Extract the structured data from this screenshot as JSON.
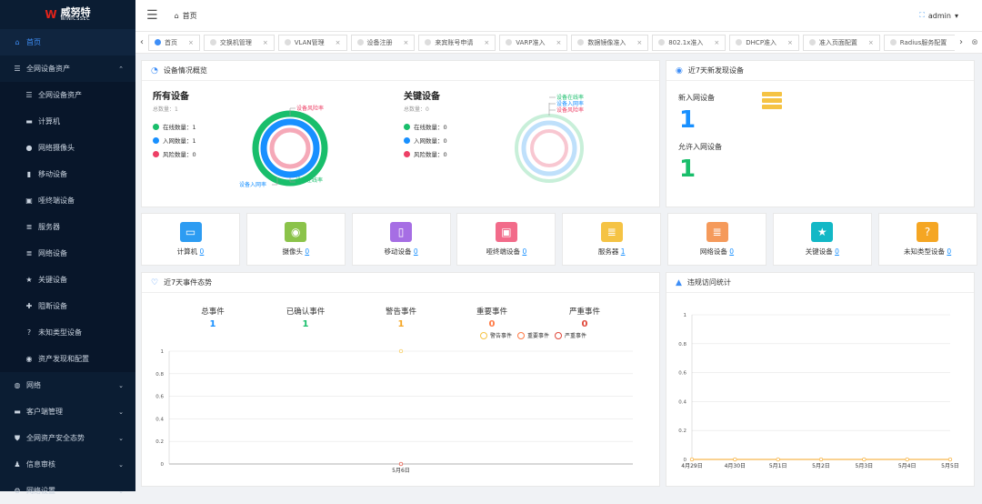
{
  "brand": {
    "name_cn": "威努特",
    "name_en": "WINICSSEC"
  },
  "sidebar": {
    "items": [
      {
        "label": "首页",
        "icon": "home-icon",
        "glyph": "⌂",
        "active": true
      },
      {
        "label": "全网设备资产",
        "icon": "list-icon",
        "glyph": "☰",
        "expanded": true
      },
      {
        "label": "全网设备资产",
        "icon": "list-icon",
        "glyph": "☰",
        "sub": true
      },
      {
        "label": "计算机",
        "icon": "computer-icon",
        "glyph": "▬",
        "sub": true
      },
      {
        "label": "网络摄像头",
        "icon": "camera-icon",
        "glyph": "●",
        "sub": true
      },
      {
        "label": "移动设备",
        "icon": "mobile-icon",
        "glyph": "▮",
        "sub": true
      },
      {
        "label": "哑终端设备",
        "icon": "printer-icon",
        "glyph": "▣",
        "sub": true
      },
      {
        "label": "服务器",
        "icon": "server-icon",
        "glyph": "≣",
        "sub": true
      },
      {
        "label": "网络设备",
        "icon": "network-device-icon",
        "glyph": "≣",
        "sub": true
      },
      {
        "label": "关键设备",
        "icon": "star-icon",
        "glyph": "★",
        "sub": true
      },
      {
        "label": "阻断设备",
        "icon": "block-icon",
        "glyph": "✚",
        "sub": true
      },
      {
        "label": "未知类型设备",
        "icon": "question-icon",
        "glyph": "?",
        "sub": true
      },
      {
        "label": "资产发现和配置",
        "icon": "compass-icon",
        "glyph": "◉",
        "sub": true
      },
      {
        "label": "网络",
        "icon": "globe-icon",
        "glyph": "◍",
        "chev": "⌄"
      },
      {
        "label": "客户端管理",
        "icon": "client-icon",
        "glyph": "▬",
        "chev": "⌄"
      },
      {
        "label": "全网资产安全态势",
        "icon": "shield-icon",
        "glyph": "⛊",
        "chev": "⌄"
      },
      {
        "label": "信息审核",
        "icon": "audit-icon",
        "glyph": "♟",
        "chev": "⌄"
      },
      {
        "label": "网络设置",
        "icon": "settings-icon",
        "glyph": "⚙",
        "chev": "⌄"
      }
    ]
  },
  "topbar": {
    "breadcrumb": "首页",
    "user": "admin"
  },
  "tabs": [
    {
      "label": "首页",
      "active": true
    },
    {
      "label": "交换机管理"
    },
    {
      "label": "VLAN管理"
    },
    {
      "label": "设备注册"
    },
    {
      "label": "来宾账号申请"
    },
    {
      "label": "VARP准入"
    },
    {
      "label": "数据镜像准入"
    },
    {
      "label": "802.1x准入"
    },
    {
      "label": "DHCP准入"
    },
    {
      "label": "准入页面配置"
    },
    {
      "label": "Radius服务配置"
    }
  ],
  "overview": {
    "title": "设备情况概览",
    "all": {
      "title": "所有设备",
      "total": "总数量：1",
      "legend": [
        {
          "label": "在线数量：1",
          "color": "#19be6b"
        },
        {
          "label": "入网数量：1",
          "color": "#1890ff"
        },
        {
          "label": "风险数量：0",
          "color": "#ed4066"
        }
      ],
      "ring_labels": {
        "risk": "设备风险率",
        "join": "设备入网率",
        "online": "设备在线率"
      }
    },
    "key": {
      "title": "关键设备",
      "total": "总数量：0",
      "legend": [
        {
          "label": "在线数量：0",
          "color": "#19be6b"
        },
        {
          "label": "入网数量：0",
          "color": "#1890ff"
        },
        {
          "label": "风险数量：0",
          "color": "#ed4066"
        }
      ],
      "ring_labels": {
        "online": "设备在线率",
        "join": "设备入网率",
        "risk": "设备风险率"
      }
    }
  },
  "recent": {
    "title": "近7天新发现设备",
    "new_label": "新入网设备",
    "new_value": "1",
    "allow_label": "允许入网设备",
    "allow_value": "1"
  },
  "categories": [
    {
      "label": "计算机",
      "count": "0",
      "color": "#2d9cf2",
      "glyph": "▭",
      "icon": "computer-icon"
    },
    {
      "label": "摄像头",
      "count": "0",
      "color": "#8bc34a",
      "glyph": "◉",
      "icon": "camera-icon"
    },
    {
      "label": "移动设备",
      "count": "0",
      "color": "#a66ee4",
      "glyph": "▯",
      "icon": "mobile-icon"
    },
    {
      "label": "哑终端设备",
      "count": "0",
      "color": "#f26b8a",
      "glyph": "▣",
      "icon": "printer-icon"
    },
    {
      "label": "服务器",
      "count": "1",
      "color": "#f5c344",
      "glyph": "≣",
      "icon": "server-icon"
    },
    {
      "label": "网络设备",
      "count": "0",
      "color": "#f59a5b",
      "glyph": "≣",
      "icon": "network-device-icon"
    },
    {
      "label": "关键设备",
      "count": "0",
      "color": "#12b8c6",
      "glyph": "★",
      "icon": "star-icon"
    },
    {
      "label": "未知类型设备",
      "count": "0",
      "color": "#f5a623",
      "glyph": "?",
      "icon": "question-icon"
    }
  ],
  "events": {
    "title": "近7天事件态势",
    "stats": [
      {
        "label": "总事件",
        "value": "1",
        "color": "#1890ff"
      },
      {
        "label": "已确认事件",
        "value": "1",
        "color": "#19be6b"
      },
      {
        "label": "警告事件",
        "value": "1",
        "color": "#f5a623"
      },
      {
        "label": "重要事件",
        "value": "0",
        "color": "#ff7a45"
      },
      {
        "label": "严重事件",
        "value": "0",
        "color": "#e0493b"
      }
    ],
    "legend": [
      {
        "label": "警告事件",
        "color": "#f5c344"
      },
      {
        "label": "重要事件",
        "color": "#ff7a45"
      },
      {
        "label": "严重事件",
        "color": "#e0493b"
      }
    ]
  },
  "access": {
    "title": "违规访问统计"
  },
  "chart_data": [
    {
      "type": "line",
      "categories": [
        "5月6日"
      ],
      "ylim": [
        0,
        1
      ],
      "yticks": [
        "0",
        "0.2",
        "0.4",
        "0.6",
        "0.8",
        "1"
      ],
      "series": [
        {
          "name": "警告事件",
          "values": [
            1
          ]
        },
        {
          "name": "重要事件",
          "values": [
            0
          ]
        },
        {
          "name": "严重事件",
          "values": [
            0
          ]
        }
      ]
    },
    {
      "type": "line",
      "categories": [
        "4月29日",
        "4月30日",
        "5月1日",
        "5月2日",
        "5月3日",
        "5月4日",
        "5月5日"
      ],
      "ylim": [
        0,
        1
      ],
      "yticks": [
        "0",
        "0.2",
        "0.4",
        "0.6",
        "0.8",
        "1"
      ],
      "series": [
        {
          "values": [
            0,
            0,
            0,
            0,
            0,
            0,
            0
          ],
          "color": "#f5a623"
        }
      ]
    }
  ]
}
